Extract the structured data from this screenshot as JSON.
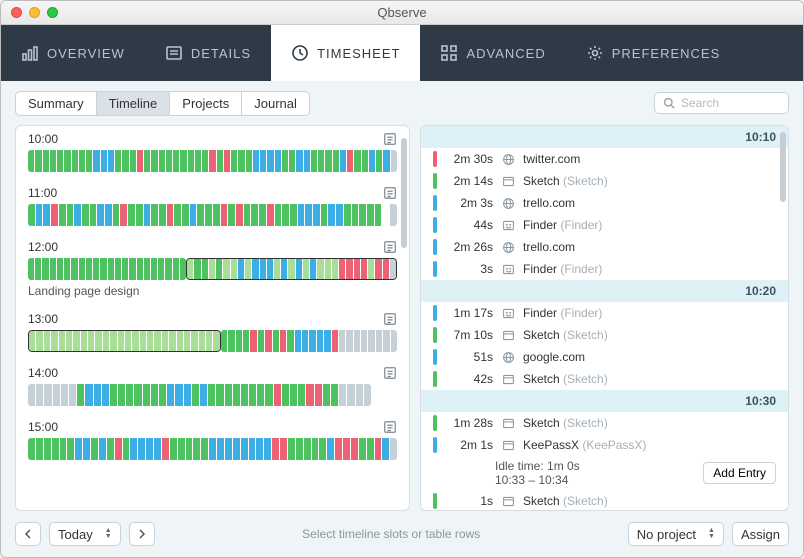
{
  "window": {
    "title": "Qbserve"
  },
  "nav": {
    "items": [
      {
        "label": "OVERVIEW",
        "icon": "bars-icon"
      },
      {
        "label": "DETAILS",
        "icon": "list-icon"
      },
      {
        "label": "TIMESHEET",
        "icon": "clock-icon",
        "active": true
      },
      {
        "label": "ADVANCED",
        "icon": "grid-icon"
      },
      {
        "label": "PREFERENCES",
        "icon": "gear-icon"
      }
    ]
  },
  "subtabs": {
    "items": [
      "Summary",
      "Timeline",
      "Projects",
      "Journal"
    ],
    "active": "Timeline"
  },
  "search": {
    "placeholder": "Search"
  },
  "timeline": {
    "blocks": [
      {
        "time": "10:00",
        "segments": "gggggggggbbbgggrgggggggggrgrgggbbbbggbbggggbrggbgbc",
        "caption": ""
      },
      {
        "time": "11:00",
        "segments": "gbbrggbggbbgrggbggrggbgggRGrgggrgggbbbgbbggggg c",
        "caption": ""
      },
      {
        "time": "12:00",
        "segments": "gggggggggggggggggggggg|LggLgLLbLbbbLbLbLbLLLrrrrLrrc",
        "caption": "Landing page design"
      },
      {
        "time": "13:00",
        "segments": "|LLLLLLLLLLLLLLLLLLLLLLLLLL|ggggrgrgrgbbbbbrcccccccc",
        "caption": ""
      },
      {
        "time": "14:00",
        "segments": "ccccccgbbbgggggggbbbgbggggggggrgggrrggcccc",
        "caption": ""
      },
      {
        "time": "15:00",
        "segments": "ggggggbbgbgrgbbbbrgggggbbbbbbbbrrgggggbrrrggrbc",
        "caption": ""
      }
    ]
  },
  "details": {
    "groups": [
      {
        "header": "10:10",
        "entries": [
          {
            "color": "#ec6174",
            "dur": "2m 30s",
            "icon": "globe",
            "name": "twitter.com",
            "sub": ""
          },
          {
            "color": "#4ec261",
            "dur": "2m 14s",
            "icon": "window",
            "name": "Sketch",
            "sub": "(Sketch)"
          },
          {
            "color": "#3daee4",
            "dur": "2m 3s",
            "icon": "globe",
            "name": "trello.com",
            "sub": ""
          },
          {
            "color": "#3daee4",
            "dur": "44s",
            "icon": "finder",
            "name": "Finder",
            "sub": "(Finder)"
          },
          {
            "color": "#3daee4",
            "dur": "2m 26s",
            "icon": "globe",
            "name": "trello.com",
            "sub": ""
          },
          {
            "color": "#3daee4",
            "dur": "3s",
            "icon": "finder",
            "name": "Finder",
            "sub": "(Finder)"
          }
        ]
      },
      {
        "header": "10:20",
        "entries": [
          {
            "color": "#3daee4",
            "dur": "1m 17s",
            "icon": "finder",
            "name": "Finder",
            "sub": "(Finder)"
          },
          {
            "color": "#4ec261",
            "dur": "7m 10s",
            "icon": "window",
            "name": "Sketch",
            "sub": "(Sketch)"
          },
          {
            "color": "#3daee4",
            "dur": "51s",
            "icon": "globe",
            "name": "google.com",
            "sub": ""
          },
          {
            "color": "#4ec261",
            "dur": "42s",
            "icon": "window",
            "name": "Sketch",
            "sub": "(Sketch)"
          }
        ]
      },
      {
        "header": "10:30",
        "entries": [
          {
            "color": "#4ec261",
            "dur": "1m 28s",
            "icon": "window",
            "name": "Sketch",
            "sub": "(Sketch)"
          },
          {
            "color": "#3daee4",
            "dur": "2m 1s",
            "icon": "window",
            "name": "KeePassX",
            "sub": "(KeePassX)"
          }
        ],
        "idle": {
          "line1": "Idle time: 1m 0s",
          "line2": "10:33 – 10:34",
          "button": "Add Entry"
        },
        "tail": [
          {
            "color": "#4ec261",
            "dur": "1s",
            "icon": "window",
            "name": "Sketch",
            "sub": "(Sketch)"
          }
        ]
      }
    ]
  },
  "footer": {
    "date": "Today",
    "hint": "Select timeline slots or table rows",
    "project": "No project",
    "assign": "Assign"
  },
  "colors": {
    "g": "#4ec261",
    "b": "#3daee4",
    "r": "#ec6174",
    "c": "#c6d1d7",
    "L": "#a8de98",
    "G": "#4ec261",
    "R": "#ec6174"
  }
}
